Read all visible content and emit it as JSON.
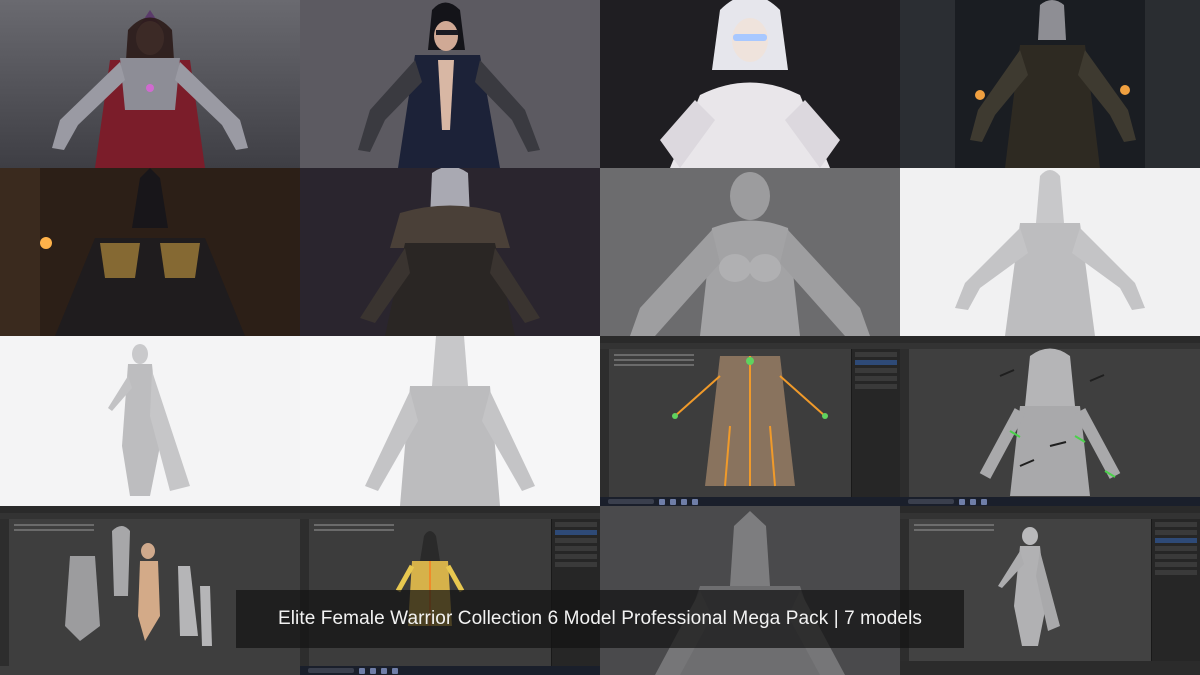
{
  "caption": "Elite Female Warrior Collection 6 Model Professional Mega Pack | 7 models",
  "tiles": [
    {
      "name": "render-crowned-sorceress-red-robe"
    },
    {
      "name": "render-masked-warrior-blue-cloak"
    },
    {
      "name": "render-white-haired-glowing-eyes"
    },
    {
      "name": "render-armored-knight-castle"
    },
    {
      "name": "render-spiked-helm-dark-armor"
    },
    {
      "name": "render-fur-collar-hooded-warrior"
    },
    {
      "name": "clay-bald-female-bust"
    },
    {
      "name": "clay-armored-warrior-white"
    },
    {
      "name": "clay-caped-warrior-standing"
    },
    {
      "name": "clay-warrior-closeup"
    },
    {
      "name": "blender-rig-viewport"
    },
    {
      "name": "blender-weight-bones-viewport"
    },
    {
      "name": "blender-exploded-parts-viewport"
    },
    {
      "name": "blender-rigged-figure-viewport"
    },
    {
      "name": "clay-armor-helmet-detail"
    },
    {
      "name": "blender-sculpt-viewport"
    }
  ]
}
